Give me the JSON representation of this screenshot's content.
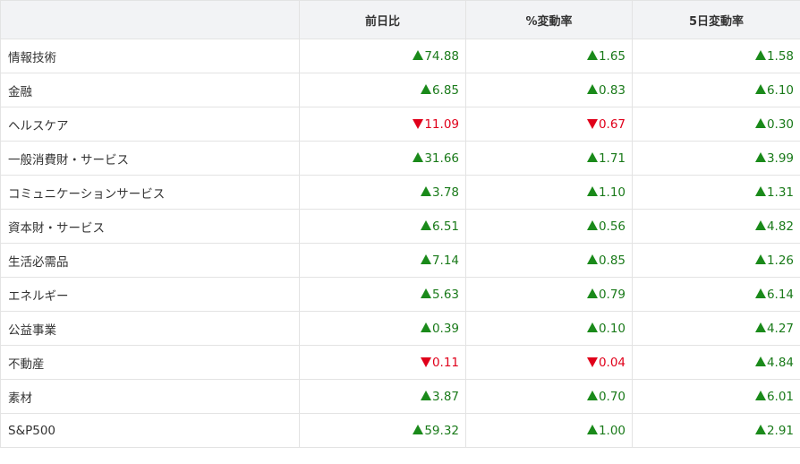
{
  "table": {
    "headers": [
      "",
      "前日比",
      "%変動率",
      "5日変動率"
    ],
    "rows": [
      {
        "name": "情報技術",
        "cells": [
          {
            "dir": "up",
            "value": "74.88"
          },
          {
            "dir": "up",
            "value": "1.65"
          },
          {
            "dir": "up",
            "value": "1.58"
          }
        ]
      },
      {
        "name": "金融",
        "cells": [
          {
            "dir": "up",
            "value": "6.85"
          },
          {
            "dir": "up",
            "value": "0.83"
          },
          {
            "dir": "up",
            "value": "6.10"
          }
        ]
      },
      {
        "name": "ヘルスケア",
        "cells": [
          {
            "dir": "down",
            "value": "11.09"
          },
          {
            "dir": "down",
            "value": "0.67"
          },
          {
            "dir": "up",
            "value": "0.30"
          }
        ]
      },
      {
        "name": "一般消費財・サービス",
        "cells": [
          {
            "dir": "up",
            "value": "31.66"
          },
          {
            "dir": "up",
            "value": "1.71"
          },
          {
            "dir": "up",
            "value": "3.99"
          }
        ]
      },
      {
        "name": "コミュニケーションサービス",
        "cells": [
          {
            "dir": "up",
            "value": "3.78"
          },
          {
            "dir": "up",
            "value": "1.10"
          },
          {
            "dir": "up",
            "value": "1.31"
          }
        ]
      },
      {
        "name": "資本財・サービス",
        "cells": [
          {
            "dir": "up",
            "value": "6.51"
          },
          {
            "dir": "up",
            "value": "0.56"
          },
          {
            "dir": "up",
            "value": "4.82"
          }
        ]
      },
      {
        "name": "生活必需品",
        "cells": [
          {
            "dir": "up",
            "value": "7.14"
          },
          {
            "dir": "up",
            "value": "0.85"
          },
          {
            "dir": "up",
            "value": "1.26"
          }
        ]
      },
      {
        "name": "エネルギー",
        "cells": [
          {
            "dir": "up",
            "value": "5.63"
          },
          {
            "dir": "up",
            "value": "0.79"
          },
          {
            "dir": "up",
            "value": "6.14"
          }
        ]
      },
      {
        "name": "公益事業",
        "cells": [
          {
            "dir": "up",
            "value": "0.39"
          },
          {
            "dir": "up",
            "value": "0.10"
          },
          {
            "dir": "up",
            "value": "4.27"
          }
        ]
      },
      {
        "name": "不動産",
        "cells": [
          {
            "dir": "down",
            "value": "0.11"
          },
          {
            "dir": "down",
            "value": "0.04"
          },
          {
            "dir": "up",
            "value": "4.84"
          }
        ]
      },
      {
        "name": "素材",
        "cells": [
          {
            "dir": "up",
            "value": "3.87"
          },
          {
            "dir": "up",
            "value": "0.70"
          },
          {
            "dir": "up",
            "value": "6.01"
          }
        ]
      },
      {
        "name": "S&P500",
        "cells": [
          {
            "dir": "up",
            "value": "59.32"
          },
          {
            "dir": "up",
            "value": "1.00"
          },
          {
            "dir": "up",
            "value": "2.91"
          }
        ]
      }
    ]
  },
  "colors": {
    "up": "#1a8a1a",
    "down": "#e0001a",
    "header_bg": "#f2f3f5",
    "border": "#e3e3e3"
  },
  "icons": {
    "up": "triangle-up-icon",
    "down": "triangle-down-icon"
  }
}
